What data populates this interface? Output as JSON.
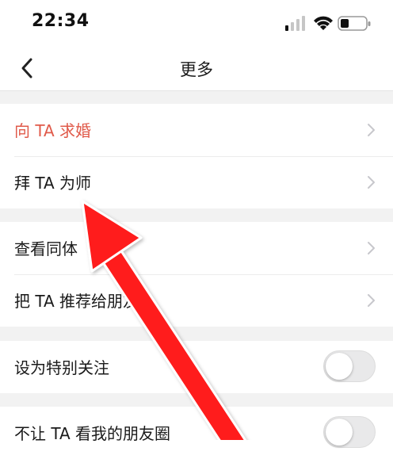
{
  "status": {
    "time": "22:34"
  },
  "nav": {
    "title": "更多"
  },
  "groups": [
    {
      "items": [
        {
          "label": "向 TA 求婚",
          "accent": "#e05a4a"
        },
        {
          "label": "拜 TA 为师"
        }
      ]
    },
    {
      "items": [
        {
          "label": "查看同体"
        },
        {
          "label": "把 TA 推荐给朋友"
        }
      ]
    },
    {
      "items": [
        {
          "label": "设为特别关注",
          "toggle_on": false
        }
      ]
    },
    {
      "items": [
        {
          "label": "不让 TA 看我的朋友圈",
          "toggle_on": false
        }
      ]
    }
  ],
  "icons": {
    "back": "chevron-left-icon",
    "row": "chevron-right-icon",
    "signal": "signal-icon",
    "wifi": "wifi-icon",
    "battery": "battery-icon",
    "annotation": "red-arrow-annotation"
  },
  "colors": {
    "annotation_arrow": "#ff1a1a",
    "chevron": "#c7c7cc"
  }
}
